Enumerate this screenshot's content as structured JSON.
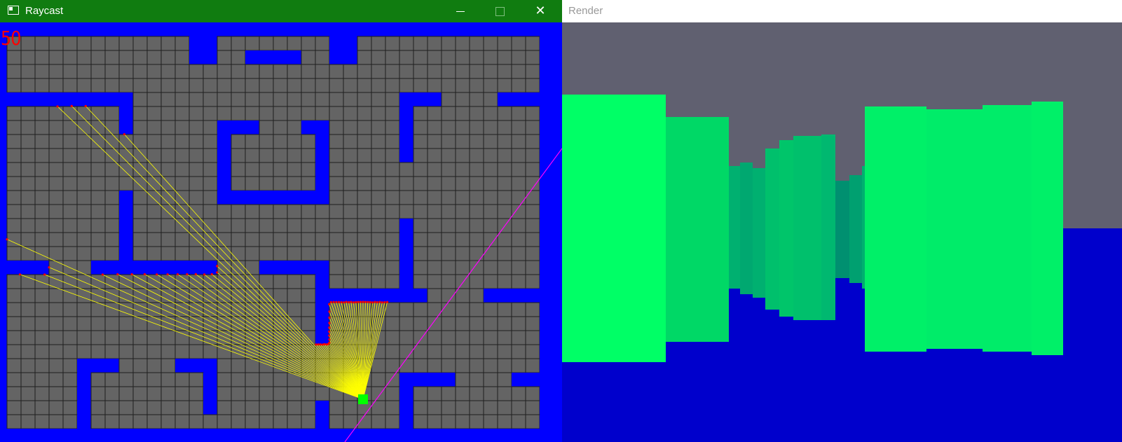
{
  "raycast_window": {
    "title": "Raycast",
    "fps": "50",
    "icon": "app-window-icon",
    "controls": [
      "minimize-icon",
      "maximize-icon",
      "close-icon"
    ]
  },
  "render_window": {
    "title": "Render"
  },
  "colors": {
    "titlebar_active": "#107c10",
    "wall": "#0000ff",
    "floor_tile": "#646464",
    "grid_line": "#1e1e1e",
    "ray": "#ffff00",
    "ray_hit": "#ff0000",
    "player": "#00ff00",
    "direction_line": "#ff00ff",
    "sky": "#606070",
    "ground": "#0000cc",
    "wall_render": "#00ff66"
  }
}
